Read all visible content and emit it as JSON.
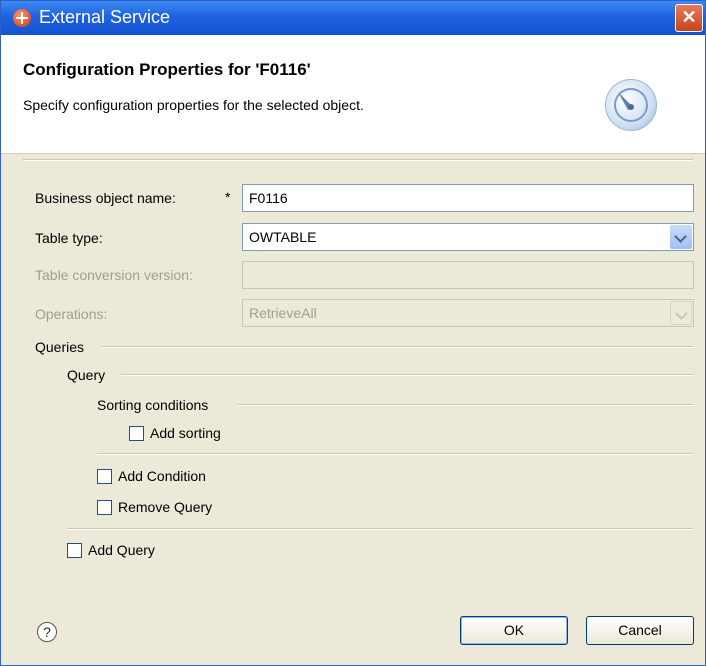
{
  "window": {
    "title": "External Service",
    "close_label": "✕"
  },
  "header": {
    "title": "Configuration Properties for 'F0116'",
    "description": "Specify configuration properties for the selected object."
  },
  "form": {
    "business_object_name": {
      "label": "Business object name:",
      "required_marker": "*",
      "value": "F0116"
    },
    "table_type": {
      "label": "Table type:",
      "value": "OWTABLE"
    },
    "table_conversion_version": {
      "label": "Table conversion version:",
      "value": ""
    },
    "operations": {
      "label": "Operations:",
      "value": "RetrieveAll"
    }
  },
  "queries": {
    "group_label": "Queries",
    "query_group_label": "Query",
    "sorting_group_label": "Sorting conditions",
    "add_sorting": "Add sorting",
    "add_condition": "Add Condition",
    "remove_query": "Remove Query",
    "add_query": "Add Query"
  },
  "footer": {
    "help_label": "?",
    "ok_label": "OK",
    "cancel_label": "Cancel"
  }
}
